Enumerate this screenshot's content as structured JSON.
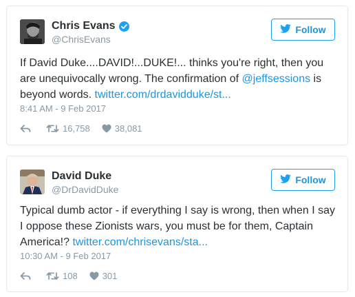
{
  "colors": {
    "accent": "#1da1f2",
    "link": "#1b95e0",
    "muted": "#8899a6",
    "text": "#292f33",
    "border": "#e1e8ed"
  },
  "tweets": [
    {
      "display_name": "Chris Evans",
      "verified": true,
      "handle": "@ChrisEvans",
      "follow_label": "Follow",
      "text_part1": "If David Duke....DAVID!...DUKE!... thinks you're right, then you are unequivocally wrong. The confirmation of ",
      "mention": "@jeffsessions",
      "text_part2": " is beyond words. ",
      "link": "twitter.com/drdavidduke/st...",
      "timestamp": "8:41 AM - 9 Feb 2017",
      "retweets": "16,758",
      "likes": "38,081",
      "icons": [
        "reply-icon",
        "retweet-icon",
        "like-icon",
        "twitter-bird-icon",
        "verified-badge-icon"
      ]
    },
    {
      "display_name": "David Duke",
      "verified": false,
      "handle": "@DrDavidDuke",
      "follow_label": "Follow",
      "text_part1": "Typical dumb actor - if everything I say is wrong, then when I say I oppose these Zionists wars, you must be for them, Captain America!? ",
      "link": "twitter.com/chrisevans/sta...",
      "timestamp": "10:30 AM - 9 Feb 2017",
      "retweets": "108",
      "likes": "301",
      "icons": [
        "reply-icon",
        "retweet-icon",
        "like-icon",
        "twitter-bird-icon"
      ]
    }
  ]
}
